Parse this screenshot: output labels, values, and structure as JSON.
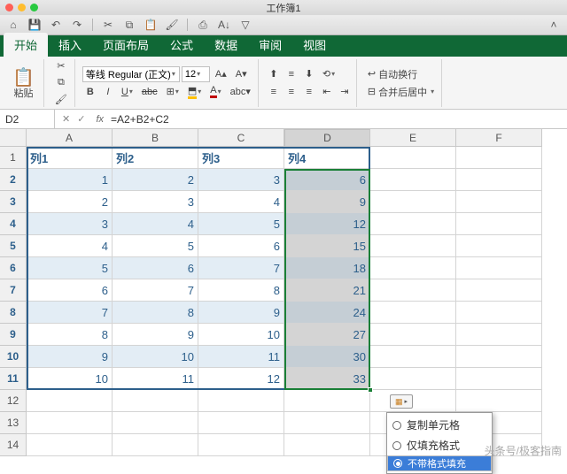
{
  "title": "工作簿1",
  "tabs": [
    "开始",
    "插入",
    "页面布局",
    "公式",
    "数据",
    "审阅",
    "视图"
  ],
  "activeTab": 0,
  "ribbon": {
    "paste": "粘贴",
    "font": "等线 Regular (正文)",
    "size": "12",
    "autowrap": "自动换行",
    "merge": "合并后居中"
  },
  "namebox": "D2",
  "formula": "=A2+B2+C2",
  "columns": [
    "A",
    "B",
    "C",
    "D",
    "E",
    "F"
  ],
  "rows": [
    1,
    2,
    3,
    4,
    5,
    6,
    7,
    8,
    9,
    10,
    11,
    12,
    13,
    14
  ],
  "headers": [
    "列1",
    "列2",
    "列3",
    "列4"
  ],
  "chart_data": {
    "type": "table",
    "columns": [
      "列1",
      "列2",
      "列3",
      "列4"
    ],
    "rows": [
      [
        1,
        2,
        3,
        6
      ],
      [
        2,
        3,
        4,
        9
      ],
      [
        3,
        4,
        5,
        12
      ],
      [
        4,
        5,
        6,
        15
      ],
      [
        5,
        6,
        7,
        18
      ],
      [
        6,
        7,
        8,
        21
      ],
      [
        7,
        8,
        9,
        24
      ],
      [
        8,
        9,
        10,
        27
      ],
      [
        9,
        10,
        11,
        30
      ],
      [
        10,
        11,
        12,
        33
      ]
    ]
  },
  "autofill": {
    "items": [
      "复制单元格",
      "仅填充格式",
      "不带格式填充"
    ],
    "selected": 2
  },
  "watermark": "头条号/极客指南"
}
